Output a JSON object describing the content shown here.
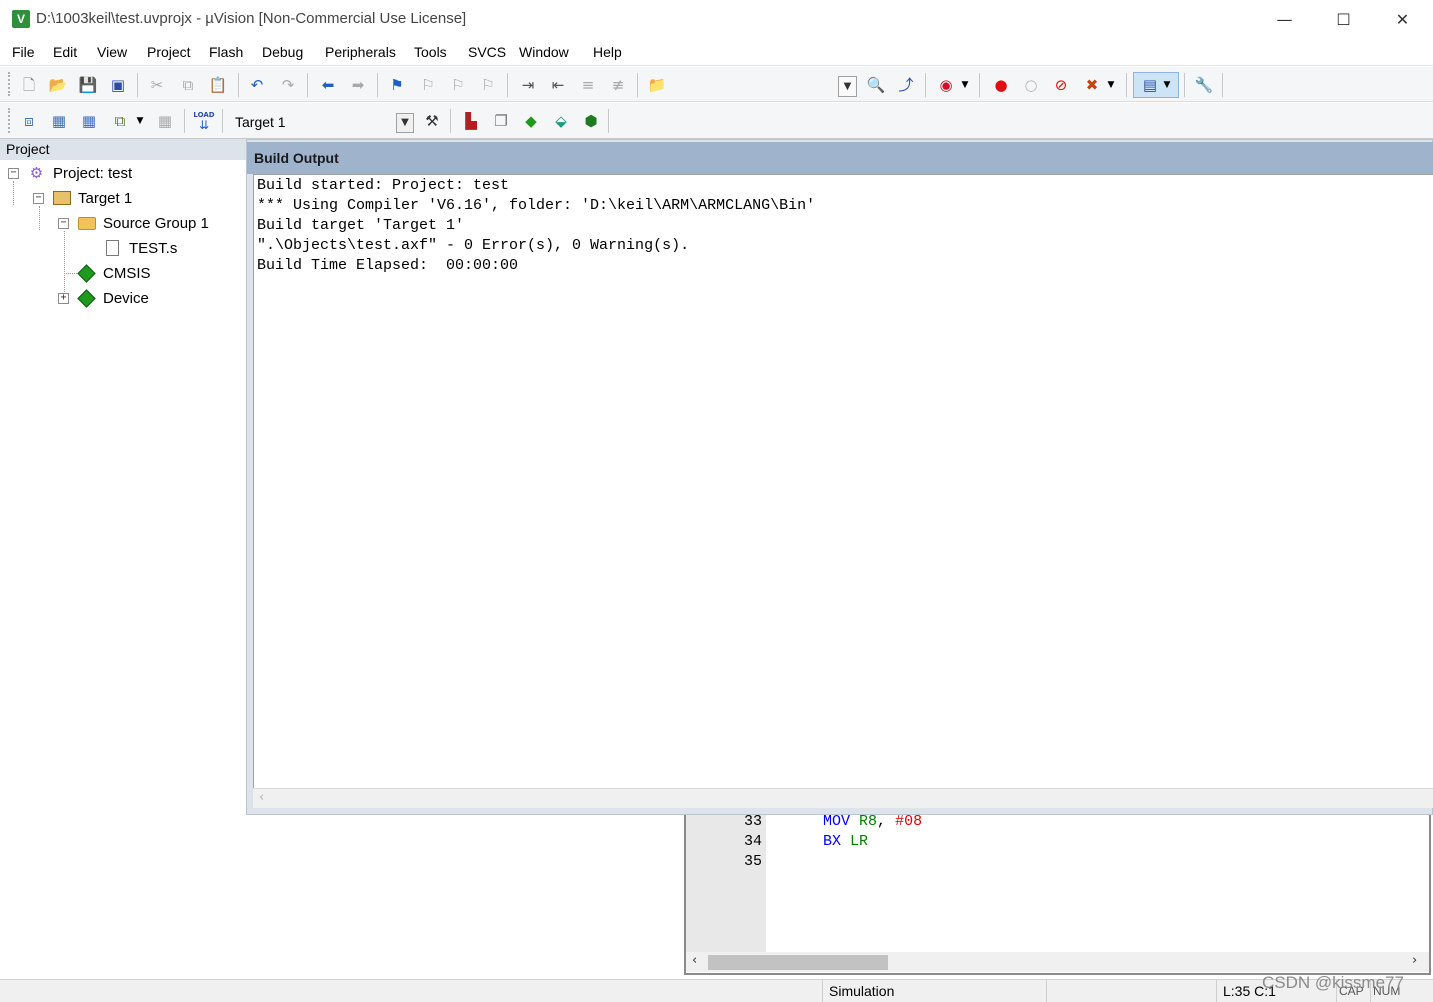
{
  "window": {
    "title": "D:\\1003keil\\test.uvprojx - µVision  [Non-Commercial Use License]",
    "app_icon_text": "V",
    "controls": {
      "minimize": "—",
      "maximize": "☐",
      "close": "✕"
    }
  },
  "menu": [
    "File",
    "Edit",
    "View",
    "Project",
    "Flash",
    "Debug",
    "Peripherals",
    "Tools",
    "SVCS",
    "Window",
    "Help"
  ],
  "toolbar1": {
    "icons": [
      "new-file-icon",
      "open-file-icon",
      "save-icon",
      "save-all-icon",
      "cut-icon",
      "copy-icon",
      "paste-icon",
      "undo-icon",
      "redo-icon",
      "navigate-back-icon",
      "navigate-forward-icon",
      "insert-bookmark-icon",
      "previous-bookmark-icon",
      "next-bookmark-icon",
      "clear-bookmarks-icon",
      "indent-icon",
      "unindent-icon",
      "comment-icon",
      "uncomment-icon",
      "find-in-files-icon",
      "find-icon",
      "incremental-find-icon",
      "debug-session-icon",
      "insert-breakpoint-icon",
      "enable-breakpoint-icon",
      "disable-breakpoints-icon",
      "kill-breakpoints-icon",
      "window-layout-icon",
      "configure-icon"
    ]
  },
  "toolbar2": {
    "target_name": "Target 1",
    "icons": [
      "translate-icon",
      "build-icon",
      "rebuild-icon",
      "batch-build-icon",
      "stop-build-icon",
      "download-icon",
      "target-options-icon",
      "file-extensions-icon",
      "manage-rte-icon",
      "select-packs-icon",
      "pack-installer-icon"
    ],
    "load_label": "LOAD"
  },
  "project": {
    "header": "Project",
    "root": "Project: test",
    "target": "Target 1",
    "group": "Source Group 1",
    "file": "TEST.s",
    "cmsis": "CMSIS",
    "device": "Device"
  },
  "build_output": {
    "header": "Build Output",
    "lines": [
      "Build started: Project: test",
      "*** Using Compiler 'V6.16', folder: 'D:\\keil\\ARM\\ARMCLANG\\Bin'",
      "Build target 'Target 1'",
      "\".\\Objects\\test.axf\" - 0 Error(s), 0 Warning(s).",
      "Build Time Elapsed:  00:00:00"
    ]
  },
  "editor": {
    "line_numbers": [
      "33",
      "34",
      "35"
    ],
    "line33": {
      "kw": "MOV",
      "reg": "R8",
      "sep": ", ",
      "num": "#08"
    },
    "line34": {
      "kw": "BX",
      "reg": "LR"
    }
  },
  "status": {
    "mode": "Simulation",
    "position": "L:35 C:1",
    "caps": "CAP",
    "num": "NUM"
  },
  "watermark": "CSDN @kissme77"
}
